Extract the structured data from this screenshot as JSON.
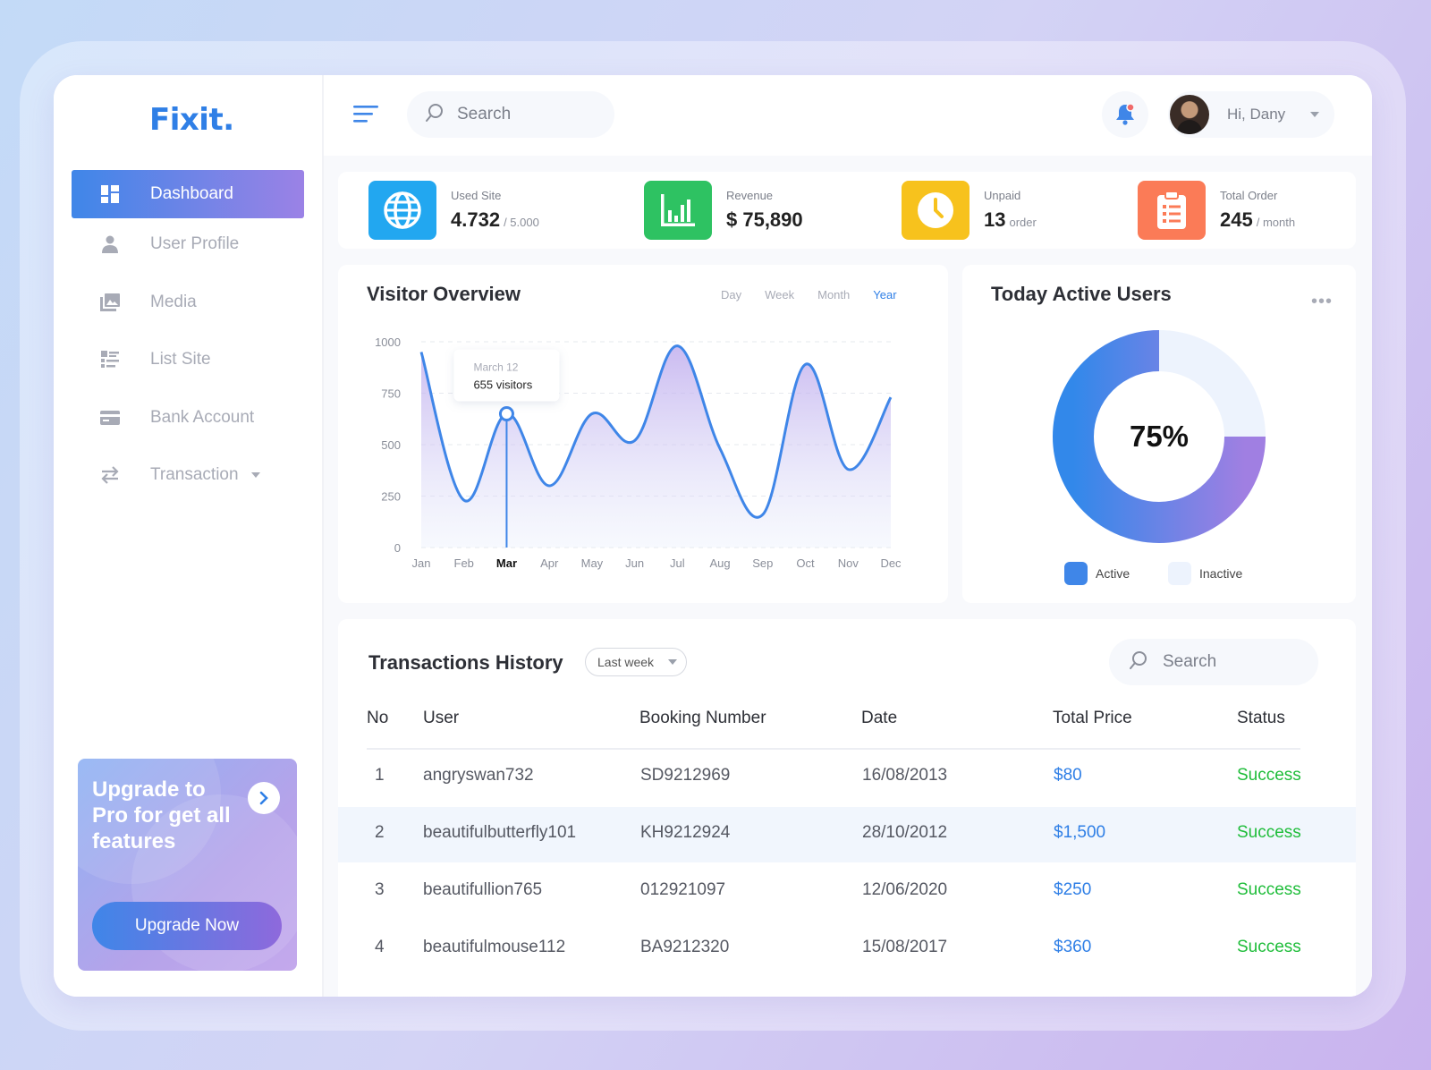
{
  "app": {
    "logo": "Fixit."
  },
  "sidebar": {
    "items": [
      {
        "label": "Dashboard",
        "icon": "dashboard-icon",
        "active": true
      },
      {
        "label": "User Profile",
        "icon": "user-icon"
      },
      {
        "label": "Media",
        "icon": "media-icon"
      },
      {
        "label": "List Site",
        "icon": "list-icon"
      },
      {
        "label": "Bank Account",
        "icon": "card-icon"
      },
      {
        "label": "Transaction",
        "icon": "transfer-icon"
      }
    ],
    "upgrade": {
      "text": "Upgrade to Pro for get all features",
      "button": "Upgrade Now"
    }
  },
  "topbar": {
    "search_placeholder": "Search",
    "greeting": "Hi, Dany",
    "notification_dot_color": "#f06a6a"
  },
  "stats": [
    {
      "label": "Used Site",
      "value": "4.732",
      "unit": "/ 5.000",
      "color": "#22a7f0",
      "icon": "globe-icon"
    },
    {
      "label": "Revenue",
      "value": "$ 75,890",
      "unit": "",
      "color": "#2ec262",
      "icon": "bar-chart-icon"
    },
    {
      "label": "Unpaid",
      "value": "13",
      "unit": "order",
      "color": "#f7c21d",
      "icon": "clock-icon"
    },
    {
      "label": "Total Order",
      "value": "245",
      "unit": "/ month",
      "color": "#fb7b57",
      "icon": "clipboard-icon"
    }
  ],
  "visitor": {
    "title": "Visitor Overview",
    "periods": [
      "Day",
      "Week",
      "Month",
      "Year"
    ],
    "selected_period": "Year",
    "tooltip": {
      "date": "March 12",
      "text": "655 visitors"
    }
  },
  "chart_data": {
    "type": "line",
    "x": [
      "Jan",
      "Feb",
      "Mar",
      "Apr",
      "May",
      "Jun",
      "Jul",
      "Aug",
      "Sep",
      "Oct",
      "Nov",
      "Dec"
    ],
    "highlight_x": "Mar",
    "series": [
      {
        "values": [
          950,
          230,
          650,
          300,
          650,
          520,
          980,
          480,
          160,
          890,
          380,
          730
        ]
      }
    ],
    "yticks": [
      0,
      250,
      500,
      750,
      1000
    ],
    "ylim": [
      0,
      1000
    ],
    "grid": true,
    "line_color": "#3f86e8"
  },
  "active_users": {
    "title": "Today Active Users",
    "percent_label": "75%",
    "active_fraction": 0.75,
    "legend": [
      {
        "label": "Active",
        "color": "#3f86e8"
      },
      {
        "label": "Inactive",
        "color": "#edf3fd"
      }
    ]
  },
  "transactions": {
    "title": "Transactions History",
    "filter": "Last week",
    "search_placeholder": "Search",
    "columns": [
      "No",
      "User",
      "Booking Number",
      "Date",
      "Total Price",
      "Status"
    ],
    "rows": [
      {
        "no": "1",
        "user": "angryswan732",
        "booking": "SD9212969",
        "date": "16/08/2013",
        "price": "$80",
        "status": "Success"
      },
      {
        "no": "2",
        "user": "beautifulbutterfly101",
        "booking": "KH9212924",
        "date": "28/10/2012",
        "price": "$1,500",
        "status": "Success"
      },
      {
        "no": "3",
        "user": "beautifullion765",
        "booking": "012921097",
        "date": "12/06/2020",
        "price": "$250",
        "status": "Success"
      },
      {
        "no": "4",
        "user": "beautifulmouse112",
        "booking": "BA9212320",
        "date": "15/08/2017",
        "price": "$360",
        "status": "Success"
      }
    ]
  }
}
